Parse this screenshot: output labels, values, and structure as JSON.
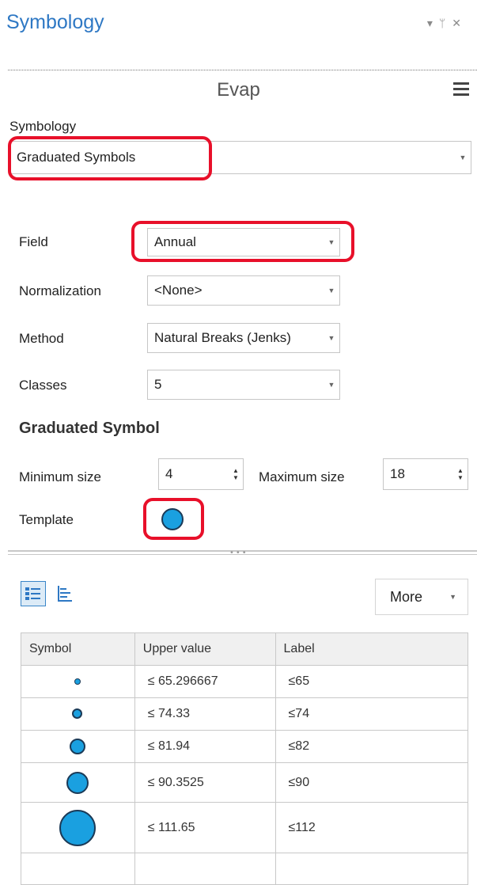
{
  "pane": {
    "title": "Symbology",
    "icons": [
      "pin-dropdown-icon",
      "pin-icon",
      "close-icon"
    ]
  },
  "layer": {
    "name": "Evap"
  },
  "symbology": {
    "label": "Symbology",
    "value": "Graduated Symbols"
  },
  "field": {
    "label": "Field",
    "value": "Annual"
  },
  "normalization": {
    "label": "Normalization",
    "value": "<None>"
  },
  "method": {
    "label": "Method",
    "value": "Natural Breaks (Jenks)"
  },
  "classes": {
    "label": "Classes",
    "value": "5"
  },
  "graduated": {
    "heading": "Graduated Symbol",
    "min_label": "Minimum size",
    "min_value": "4",
    "max_label": "Maximum size",
    "max_value": "18",
    "template_label": "Template"
  },
  "toolbar": {
    "more_label": "More"
  },
  "table": {
    "headers": [
      "Symbol",
      "Upper value",
      "Label"
    ],
    "rows": [
      {
        "upper": "≤  65.296667",
        "label": "≤65"
      },
      {
        "upper": "≤  74.33",
        "label": "≤74"
      },
      {
        "upper": "≤  81.94",
        "label": "≤82"
      },
      {
        "upper": "≤  90.3525",
        "label": "≤90"
      },
      {
        "upper": "≤  111.65",
        "label": "≤112"
      }
    ]
  },
  "colors": {
    "accent": "#2e78c4",
    "symbol_fill": "#1aa0e0",
    "highlight": "#e8102a"
  }
}
